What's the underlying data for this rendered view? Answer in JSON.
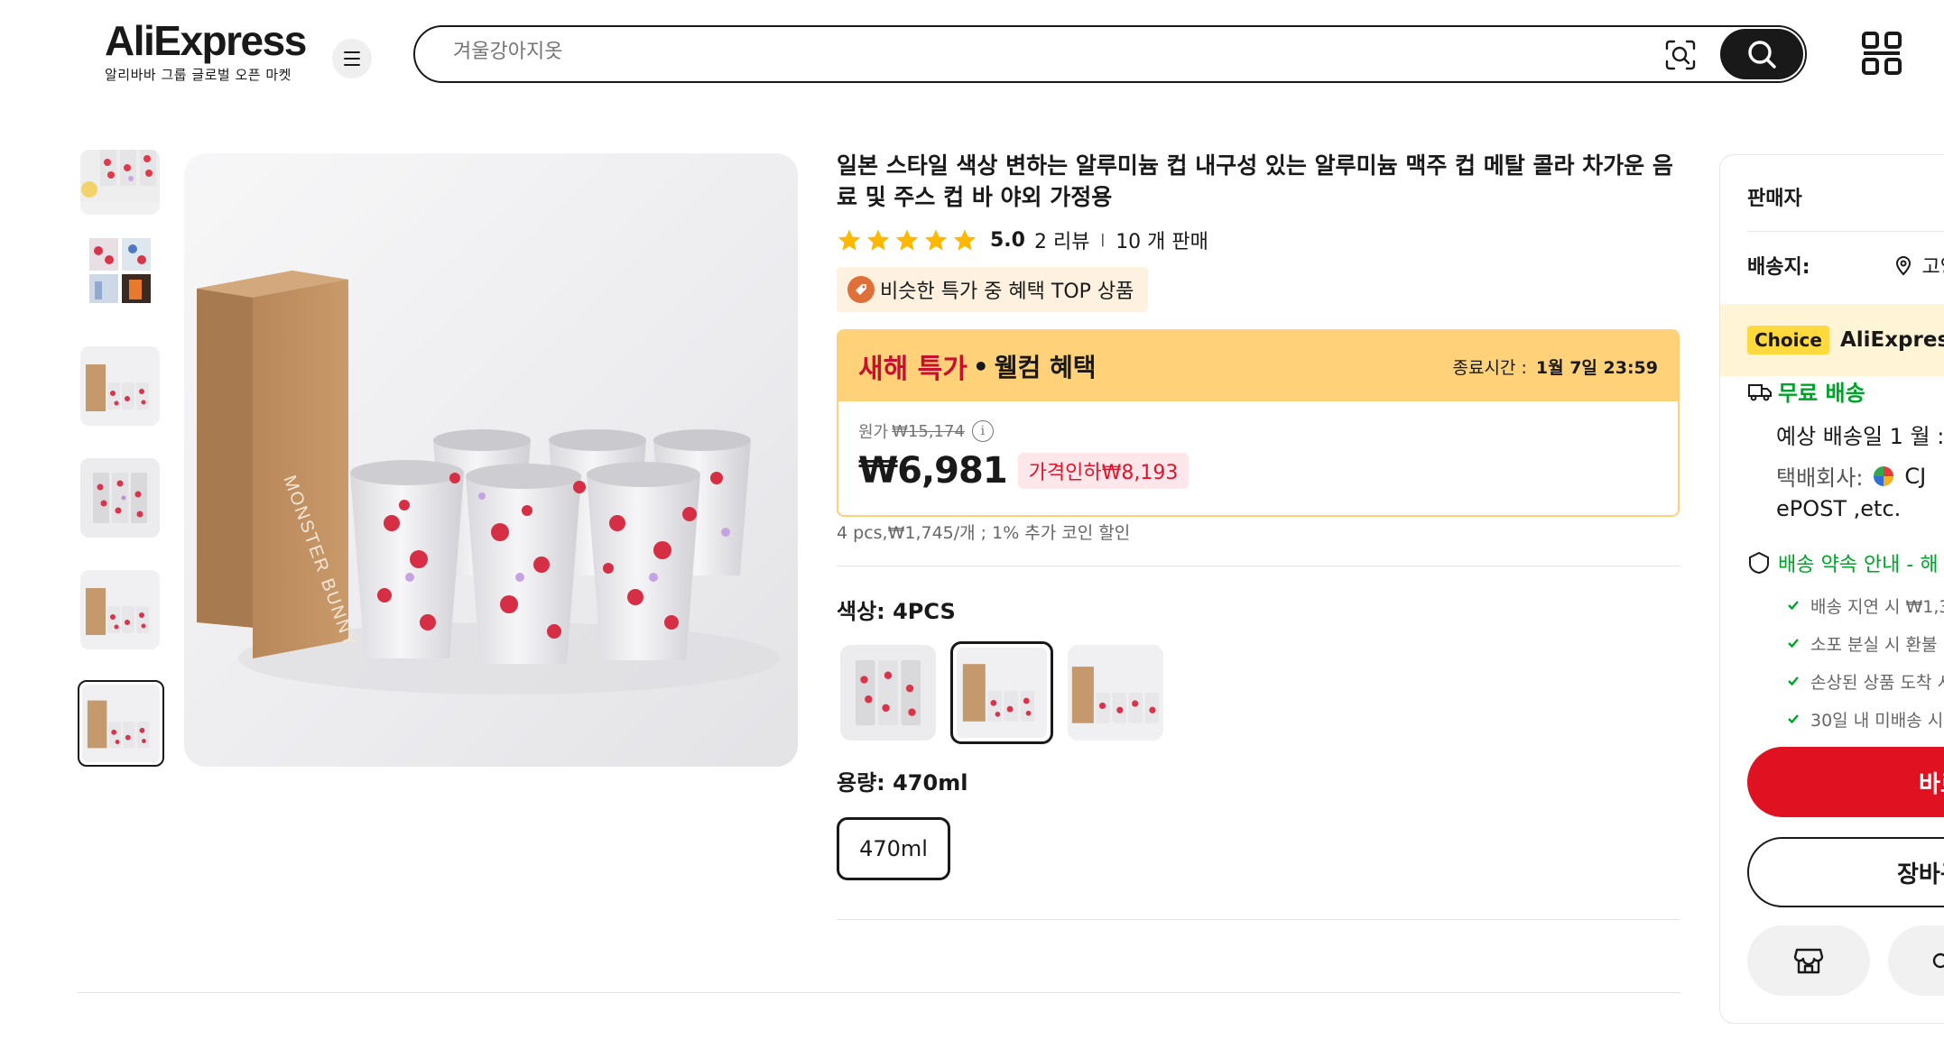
{
  "header": {
    "logo_text": "AliExpress",
    "logo_tagline": "알리바바 그룹 글로벌 오픈 마켓",
    "search_placeholder": "겨울강아지옷"
  },
  "product": {
    "title": "일본 스타일 색상 변하는 알루미늄 컵 내구성 있는 알루미늄 맥주 컵 메탈 콜라 차가운 음료 및 주스 컵 바 야외 가정용",
    "rating": "5.0",
    "rating_value": 5,
    "reviews": "2 리뷰",
    "sales": "10 개 판매",
    "top_badge": "비슷한 특가 중 혜택 TOP 상품"
  },
  "deal": {
    "name": "새해 특가",
    "separator": "•",
    "subtitle": "웰컴 혜택",
    "end_label": "종료시간 :",
    "end_time": "1월 7일 23:59",
    "original_label": "원가",
    "original_price": "₩15,174",
    "info_icon": "i",
    "price": "₩6,981",
    "drop_badge": "가격인하₩8,193",
    "unit_note": "4 pcs,₩1,745/개 ; 1% 추가 코인 할인"
  },
  "sku": {
    "color_label": "색상: 4PCS",
    "color_options": [
      "silver-cups",
      "box-and-cups",
      "box-and-cups-alt"
    ],
    "color_selected_index": 1,
    "size_label": "용량: 470ml",
    "size_options": [
      "470ml"
    ]
  },
  "panel": {
    "seller_label": "판매자",
    "ship_to_label": "배송지:",
    "ship_to_value": "고양시",
    "choice_tag": "Choice",
    "choice_brand": "AliExpress",
    "free_shipping": "무료 배송",
    "est_delivery": "예상 배송일 1 월 :",
    "courier": "택배회사:",
    "courier_name": "CJ",
    "courier_more": "ePOST ,etc.",
    "promise": "배송 약속 안내 - 해",
    "checks": [
      "배송 지연 시 ₩1,3",
      "소포 분실 시 환불",
      "손상된 상품 도착 시",
      "30일 내 미배송 시"
    ],
    "buy_label": "바로",
    "cart_label": "장바구"
  },
  "colors": {
    "accent_red": "#e01222",
    "deal_yellow": "#ffd27a",
    "success_green": "#00a32a",
    "star": "#ffb800"
  },
  "icons": {
    "menu": "hamburger-icon",
    "image_search": "camera-search-icon",
    "search": "search-icon",
    "qr": "qr-code-icon",
    "star": "star-icon",
    "info": "info-icon",
    "location": "location-pin-icon",
    "truck": "truck-icon",
    "shield": "shield-icon",
    "check": "check-icon",
    "store": "store-icon"
  }
}
